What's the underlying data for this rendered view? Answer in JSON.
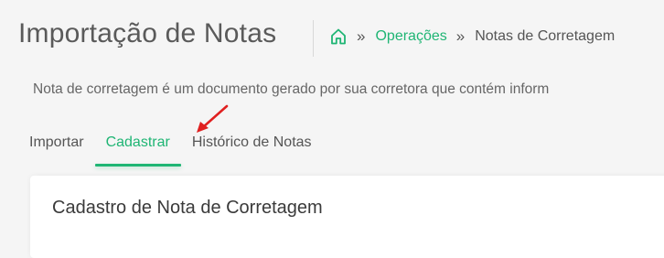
{
  "header": {
    "title": "Importação de Notas"
  },
  "breadcrumb": {
    "home_icon": "home-icon",
    "separator": "»",
    "items": [
      {
        "label": "Operações"
      },
      {
        "label": "Notas de Corretagem"
      }
    ]
  },
  "description": "Nota de corretagem é um documento gerado por sua corretora que contém inform",
  "tabs": [
    {
      "label": "Importar",
      "active": false
    },
    {
      "label": "Cadastrar",
      "active": true
    },
    {
      "label": "Histórico de Notas",
      "active": false
    }
  ],
  "card": {
    "title": "Cadastro de Nota de Corretagem"
  },
  "colors": {
    "accent": "#1fb574",
    "annotation_arrow": "#e02020",
    "background": "#f5f5f5"
  }
}
